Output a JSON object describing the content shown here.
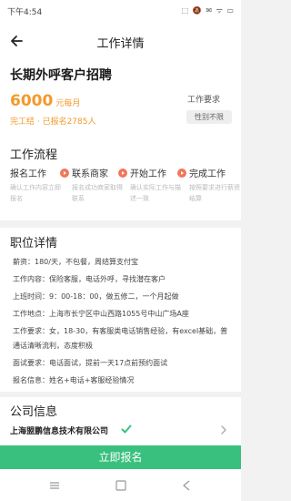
{
  "status_bar": {
    "time": "下午4:54",
    "indicators": "⬚ 🔕 ✉ ᯤ ▭"
  },
  "header": {
    "title": "工作详情"
  },
  "job": {
    "title": "长期外呼客户招聘",
    "salary_amount": "6000",
    "salary_unit": "元每月",
    "settle_info": "完工结 · 已报名2785人",
    "requirement_label": "工作要求",
    "requirement_value": "性别不限"
  },
  "flow": {
    "title": "工作流程",
    "steps": [
      {
        "name": "报名工作",
        "desc": "确认工作内容立即报名"
      },
      {
        "name": "联系商家",
        "desc": "报名成功商家取得联系"
      },
      {
        "name": "开始工作",
        "desc": "确认实际工作与描述一致"
      },
      {
        "name": "完成工作",
        "desc": "按照要求进行薪资结算"
      }
    ]
  },
  "detail": {
    "title": "职位详情",
    "lines": [
      "薪资：180/天，不包餐，周结算支付宝",
      "工作内容：保险客服，电话外呼，寻找潜在客户",
      "上班时间：9：00-18：00，做五修二，一个月起做",
      "工作地点：上海市长宁区中山西路1055号中山广场A座",
      "工作要求：女，18-30，有客服类电话销售经验，有excel基础，普通话清晰流利，态度积极",
      "面试要求：电话面试，提前一天17点前预约面试",
      "报名信息：姓名+电话+客服经验情况"
    ]
  },
  "company": {
    "title": "公司信息",
    "name": "上海盟鹏信息技术有限公司"
  },
  "actions": {
    "apply_label": "立即报名"
  },
  "colors": {
    "accent_orange": "#f39a2b",
    "apply_green": "#3ac07e",
    "step_icon": "#f0775a"
  }
}
